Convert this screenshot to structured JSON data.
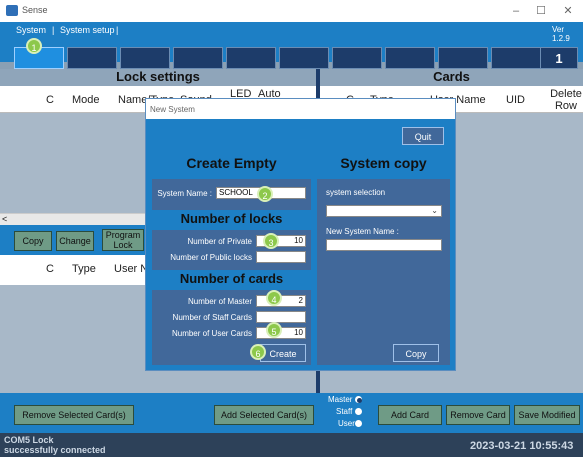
{
  "window": {
    "title": "Sense",
    "minimize": "–",
    "maximize": "☐",
    "close": "✕"
  },
  "menu": {
    "system": "System",
    "system_setup": "System setup",
    "sep1": "|",
    "sep2": "|",
    "version": "Ver 1.2.9"
  },
  "tabs": {
    "page_number": "1"
  },
  "lock_settings": {
    "title": "Lock settings",
    "columns": [
      "C",
      "Mode",
      "Name/Type",
      "Sound",
      "LED",
      "Auto Unlock"
    ],
    "scroll_left": "<",
    "buttons": {
      "copy": "Copy",
      "change": "Change",
      "program_lock": "Program Lock"
    },
    "columns2": [
      "C",
      "Type",
      "User N"
    ]
  },
  "cards": {
    "title": "Cards",
    "columns": [
      "C",
      "Type",
      "User Name",
      "UID",
      "Delete Row"
    ]
  },
  "bottom": {
    "remove_selected": "Remove Selected Card(s)",
    "add_selected": "Add Selected Card(s)",
    "radio_master": "Master",
    "radio_staff": "Staff",
    "radio_user": "User",
    "add_card": "Add Card",
    "remove_card": "Remove Card",
    "save_modified": "Save Modified"
  },
  "status": {
    "line1": "COM5 Lock",
    "line2": "successfully connected",
    "datetime": "2023-03-21 10:55:43"
  },
  "dialog": {
    "title": "New System",
    "quit": "Quit",
    "create_empty": {
      "title": "Create Empty",
      "system_name_label": "System Name :",
      "system_name_value": "SCHOOL",
      "locks_title": "Number of locks",
      "private_label": "Number of Private",
      "private_value": "10",
      "public_label": "Number of Public locks",
      "public_value": "",
      "cards_title": "Number of cards",
      "master_label": "Number of Master",
      "master_value": "2",
      "staff_label": "Number of Staff Cards",
      "staff_value": "",
      "user_label": "Number of User Cards",
      "user_value": "10",
      "create": "Create"
    },
    "system_copy": {
      "title": "System copy",
      "selection_label": "system selection",
      "selection_value": "",
      "new_name_label": "New System Name :",
      "new_name_value": "",
      "copy": "Copy"
    }
  },
  "badges": [
    "1",
    "2",
    "3",
    "4",
    "5",
    "6"
  ]
}
